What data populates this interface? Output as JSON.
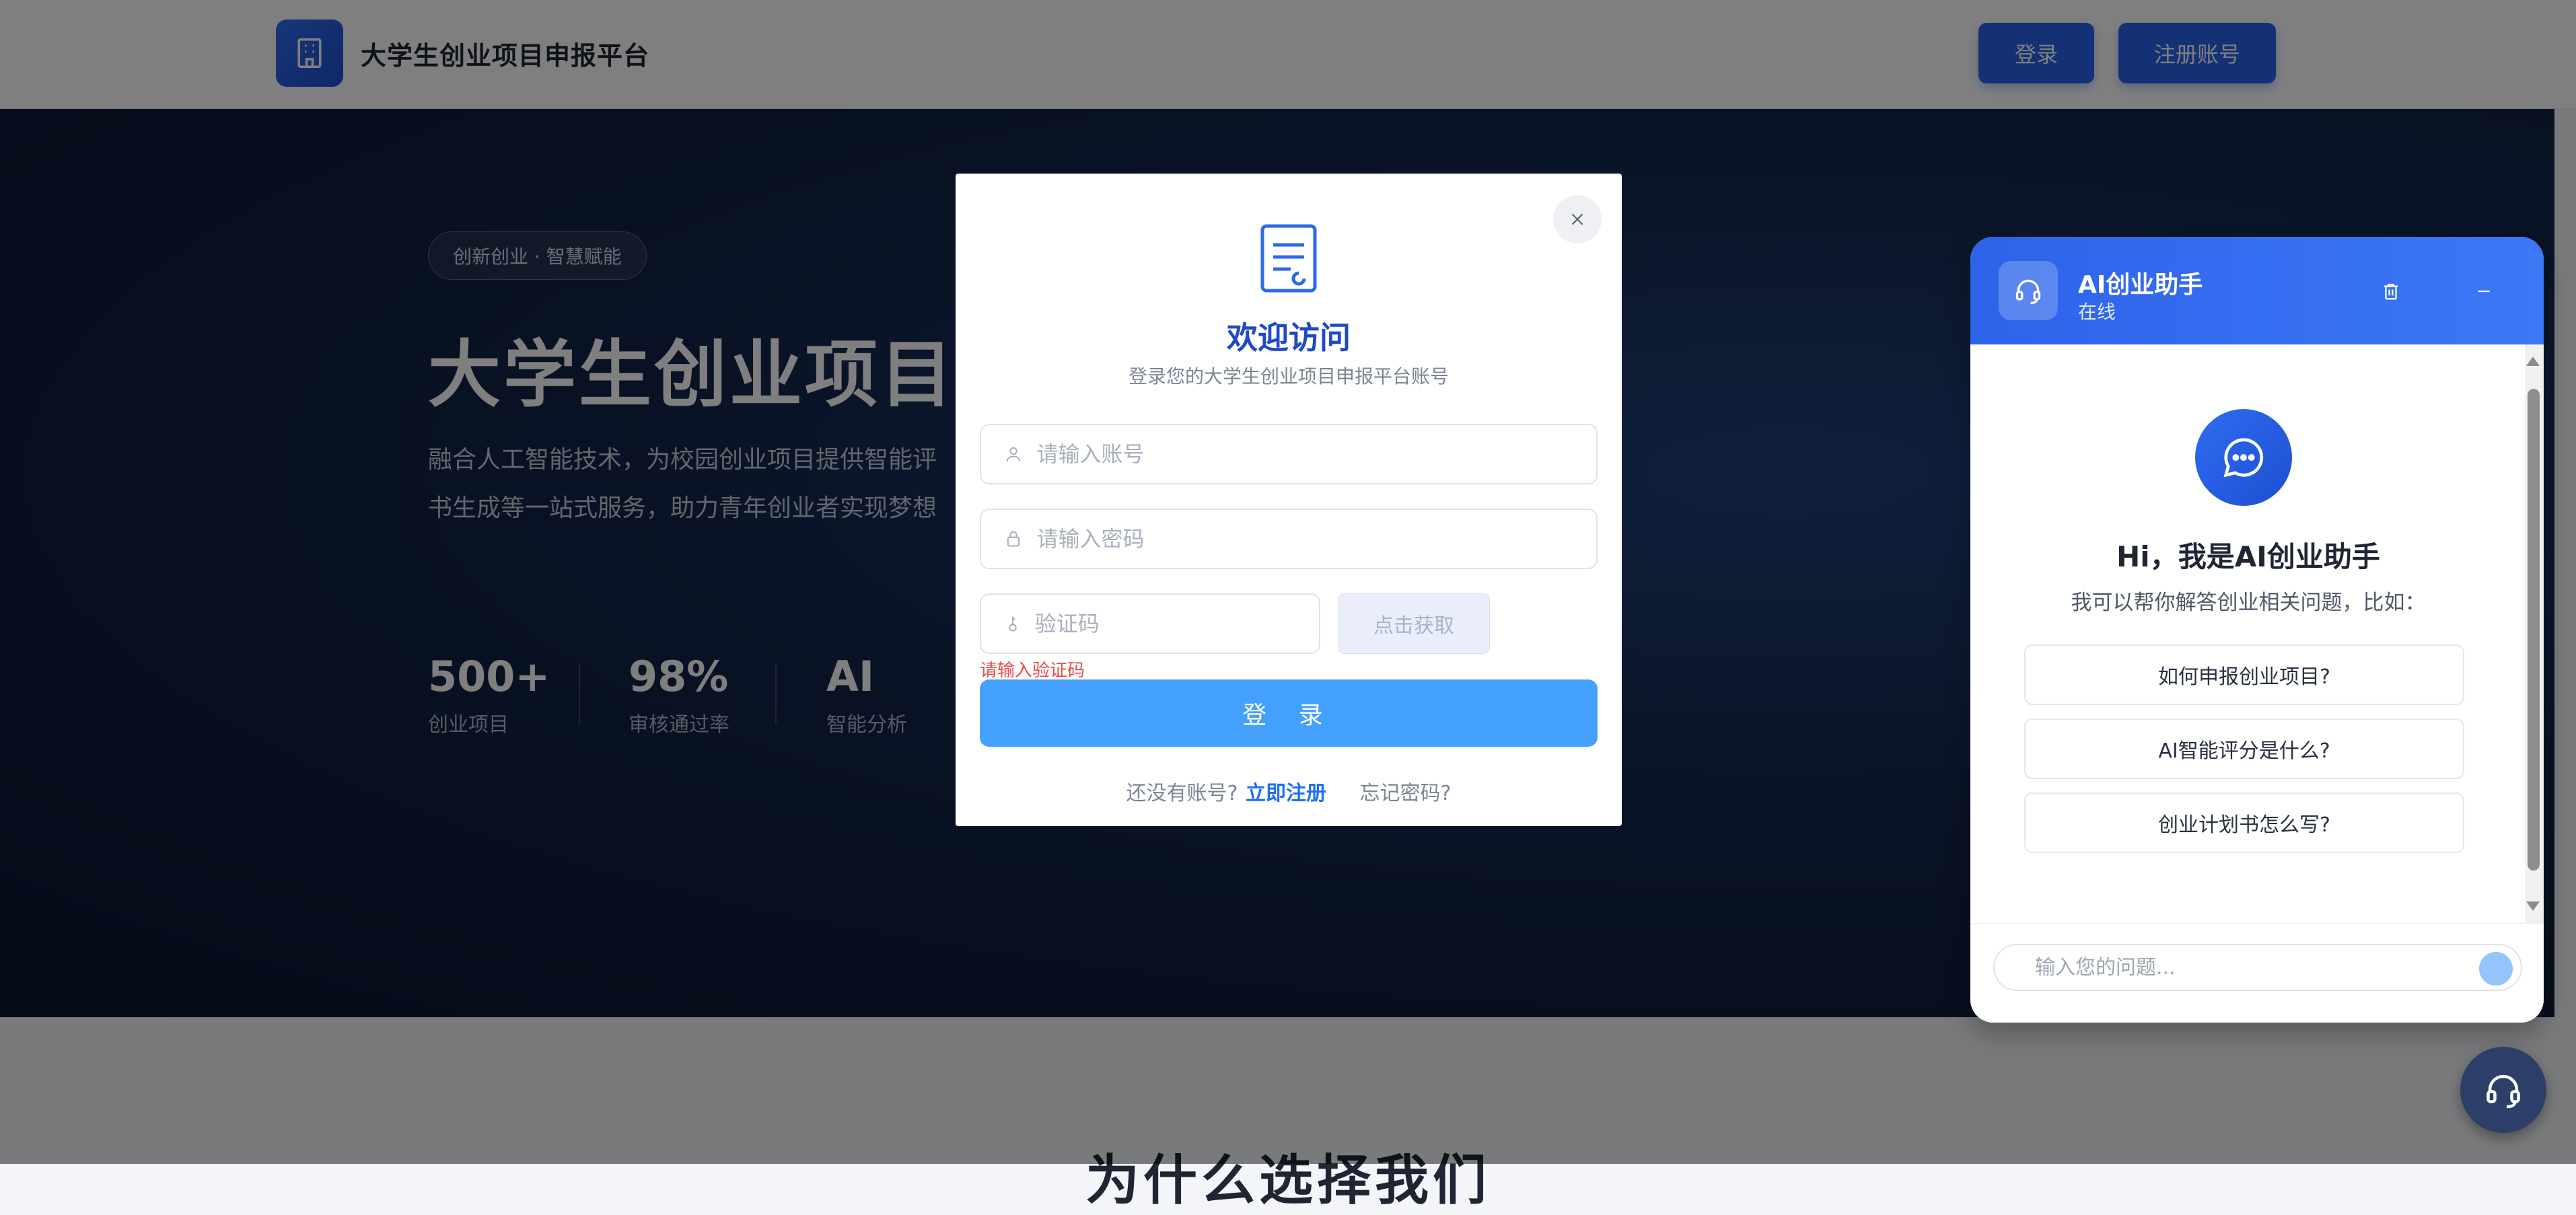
{
  "header": {
    "brand_name": "大学生创业项目申报平台",
    "login_label": "登录",
    "register_label": "注册账号"
  },
  "hero": {
    "pill": "创新创业 · 智慧赋能",
    "title": "大学生创业项目申报平台",
    "desc_line1": "融合人工智能技术，为校园创业项目提供智能评",
    "desc_line2": "书生成等一站式服务，助力青年创业者实现梦想",
    "stats": [
      {
        "value": "500+",
        "label": "创业项目"
      },
      {
        "value": "98%",
        "label": "审核通过率"
      },
      {
        "value": "AI",
        "label": "智能分析"
      }
    ]
  },
  "section": {
    "heading": "为什么选择我们"
  },
  "login_modal": {
    "icon": "document-icon",
    "title": "欢迎访问",
    "subtitle": "登录您的大学生创业项目申报平台账号",
    "account_placeholder": "请输入账号",
    "password_placeholder": "请输入密码",
    "code_placeholder": "验证码",
    "get_code_label": "点击获取",
    "code_error": "请输入验证码",
    "submit_label": "登 录",
    "no_account_text": "还没有账号?",
    "register_link": "立即注册",
    "forgot_link": "忘记密码?"
  },
  "assistant": {
    "title": "AI创业助手",
    "status": "在线",
    "greeting": "Hi，我是AI创业助手",
    "hint": "我可以帮你解答创业相关问题，比如：",
    "suggestions": [
      "如何申报创业项目?",
      "AI智能评分是什么?",
      "创业计划书怎么写?"
    ],
    "input_placeholder": "输入您的问题..."
  },
  "colors": {
    "primary": "#2b63ea",
    "login_button": "#43a0fd",
    "error": "#ee4b4b",
    "link": "#1f6ff0"
  }
}
